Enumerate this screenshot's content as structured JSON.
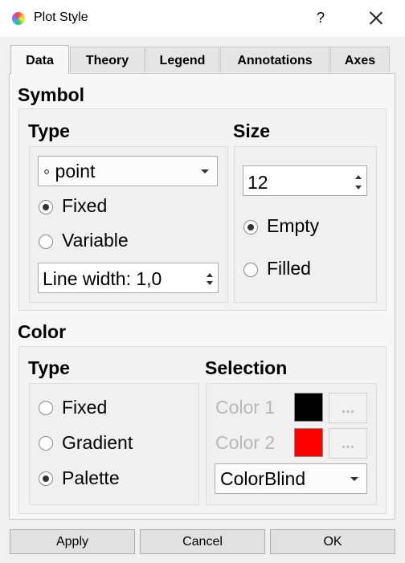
{
  "window": {
    "title": "Plot Style",
    "help_label": "?"
  },
  "tabs": [
    {
      "label": "Data",
      "active": true
    },
    {
      "label": "Theory",
      "active": false
    },
    {
      "label": "Legend",
      "active": false
    },
    {
      "label": "Annotations",
      "active": false
    },
    {
      "label": "Axes",
      "active": false
    }
  ],
  "symbol": {
    "section_title": "Symbol",
    "type": {
      "title": "Type",
      "combo_value": "◦ point",
      "options": [
        {
          "label": "Fixed",
          "checked": true
        },
        {
          "label": "Variable",
          "checked": false
        }
      ],
      "line_width": "Line width: 1,0"
    },
    "size": {
      "title": "Size",
      "value": "12",
      "options": [
        {
          "label": "Empty",
          "checked": true
        },
        {
          "label": "Filled",
          "checked": false
        }
      ]
    }
  },
  "color": {
    "section_title": "Color",
    "type": {
      "title": "Type",
      "options": [
        {
          "label": "Fixed",
          "checked": false
        },
        {
          "label": "Gradient",
          "checked": false
        },
        {
          "label": "Palette",
          "checked": true
        }
      ]
    },
    "selection": {
      "title": "Selection",
      "color1": {
        "label": "Color 1",
        "swatch": "#000000",
        "button_label": "..."
      },
      "color2": {
        "label": "Color 2",
        "swatch": "#ff0000",
        "button_label": "..."
      },
      "palette_value": "ColorBlind"
    }
  },
  "footer": {
    "apply_label": "Apply",
    "cancel_label": "Cancel",
    "ok_label": "OK"
  }
}
